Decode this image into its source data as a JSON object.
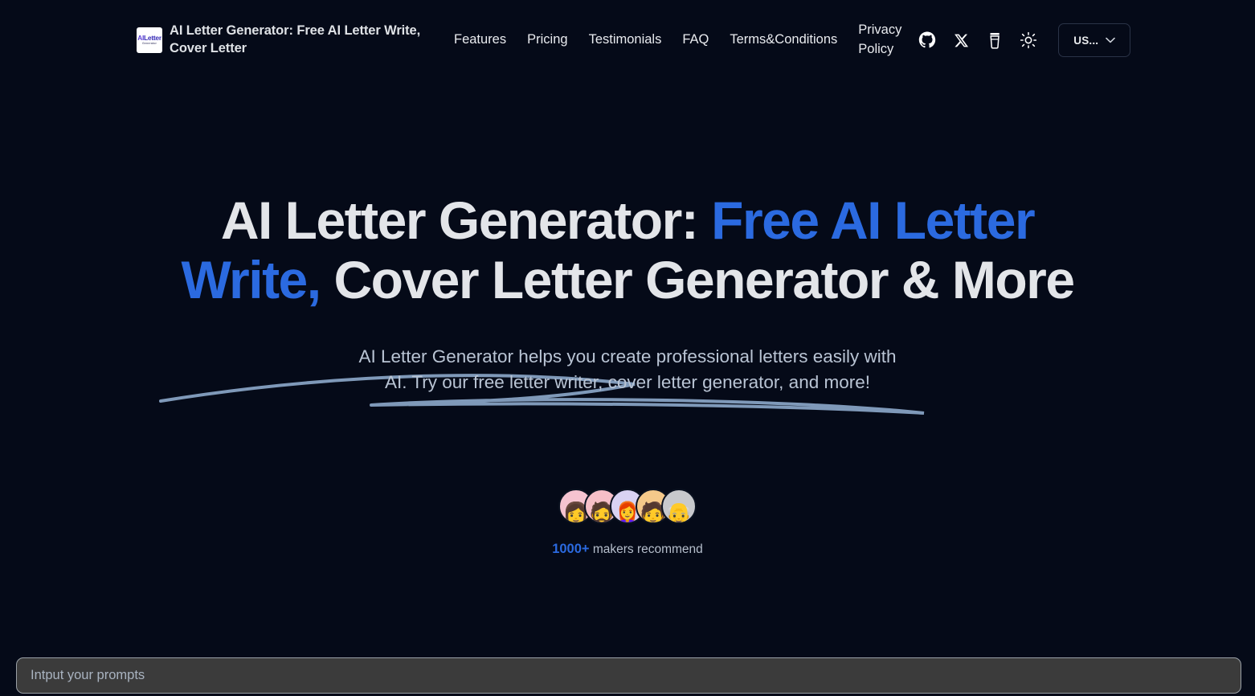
{
  "header": {
    "brand": {
      "logo_top": "AILetter",
      "logo_top_a": "AI",
      "logo_top_b": "Letter",
      "logo_sub": "Generator",
      "title": "AI Letter Generator: Free AI Letter Write, Cover Letter"
    },
    "nav": [
      {
        "label": "Features"
      },
      {
        "label": "Pricing"
      },
      {
        "label": "Testimonials"
      },
      {
        "label": "FAQ"
      },
      {
        "label": "Terms&Conditions"
      },
      {
        "label": "Privacy Policy"
      }
    ],
    "icons": [
      {
        "name": "github-icon",
        "title": "GitHub"
      },
      {
        "name": "x-twitter-icon",
        "title": "X"
      },
      {
        "name": "buy-me-a-coffee-icon",
        "title": "Buy Me a Coffee"
      },
      {
        "name": "sun-icon",
        "title": "Toggle theme"
      }
    ],
    "language": {
      "label": "US...",
      "chevron": "chevron-down-icon"
    }
  },
  "hero": {
    "title_line1": "AI Letter Generator:",
    "title_accent": "Free AI Letter Write,",
    "title_rest": " Cover Letter Generator & More",
    "subtitle": "AI Letter Generator helps you create professional letters easily with AI. Try our free letter writer, cover letter generator, and more!"
  },
  "social_proof": {
    "avatars": [
      {
        "bg": "#f5c3d0",
        "emoji": "👩"
      },
      {
        "bg": "#f6bfc8",
        "emoji": "🧔"
      },
      {
        "bg": "#d9d2f2",
        "emoji": "👩‍🦰"
      },
      {
        "bg": "#f5c98a",
        "emoji": "🧑"
      },
      {
        "bg": "#c8c9cc",
        "emoji": "👴"
      }
    ],
    "count": "1000+",
    "count_suffix": " makers recommend"
  },
  "prompt": {
    "placeholder": "Intput your prompts",
    "value": ""
  },
  "colors": {
    "background": "#050a18",
    "accent_blue": "#2b6ae0",
    "heading": "#e3e5e9",
    "subtitle": "#b9c4d4",
    "swoosh": "#8aa6c8",
    "prompt_bg": "#3b3b3b",
    "prompt_border": "#9aa0a6"
  }
}
